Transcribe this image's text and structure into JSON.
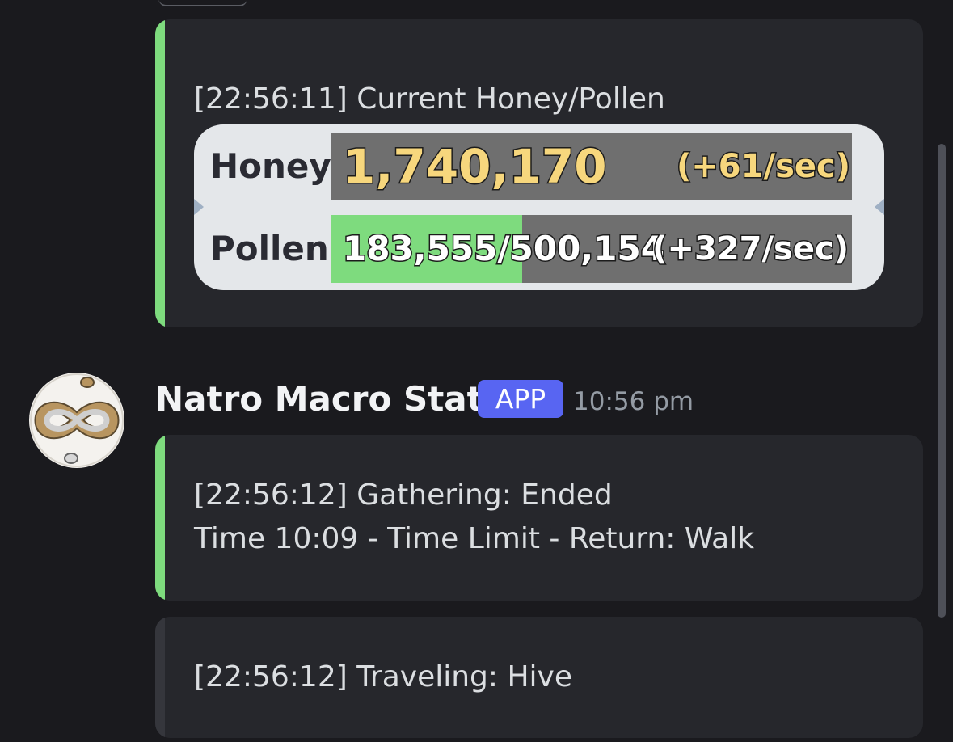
{
  "embeds": [
    {
      "accent": "#7edb7e",
      "text": "[22:56:11] Current Honey/Pollen",
      "game": {
        "honey": {
          "label": "Honey",
          "value": "1,740,170",
          "rate": "(+61/sec)"
        },
        "pollen": {
          "label": "Pollen",
          "value": "183,555/500,154",
          "rate": "(+327/sec)",
          "fill_fraction": 0.367
        }
      }
    },
    {
      "accent": "#7edb7e",
      "line1": "[22:56:12] Gathering: Ended",
      "line2": "Time 10:09 - Time Limit - Return: Walk"
    },
    {
      "accent": "#35363c",
      "text": "[22:56:12] Traveling: Hive"
    }
  ],
  "message": {
    "username": "Natro Macro Stats",
    "badge": "APP",
    "timestamp": "10:56 pm",
    "avatar_icon": "ouroboros-infinity-snakes-icon"
  },
  "colors": {
    "background": "#1a1a1e",
    "embed_bg": "#26272c",
    "badge": "#5865f2",
    "honey_text": "#f7d77d",
    "pollen_fill": "#7edb7e"
  }
}
